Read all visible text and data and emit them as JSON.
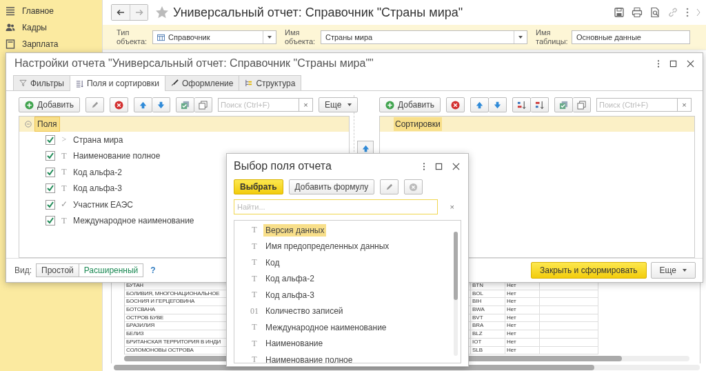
{
  "sidebar": {
    "items": [
      {
        "label": "Главное"
      },
      {
        "label": "Кадры"
      },
      {
        "label": "Зарплата"
      }
    ]
  },
  "header": {
    "title": "Универсальный отчет: Справочник \"Страны мира\""
  },
  "filters": [
    {
      "label": "Тип объекта:",
      "value": "Справочник",
      "kind": "select"
    },
    {
      "label": "Имя объекта:",
      "value": "Страны мира",
      "kind": "select"
    },
    {
      "label": "Имя таблицы:",
      "value": "Основные данные",
      "kind": "field"
    }
  ],
  "report": {
    "rows": [
      [
        "БУТАН",
        "BTN",
        "Нет"
      ],
      [
        "БОЛИВИЯ, МНОГОНАЦИОНАЛЬНОЕ",
        "BOL",
        "Нет"
      ],
      [
        "БОСНИЯ И ГЕРЦЕГОВИНА",
        "BIH",
        "Нет"
      ],
      [
        "БОТСВАНА",
        "BWA",
        "Нет"
      ],
      [
        "ОСТРОВ БУВЕ",
        "BVT",
        "Нет"
      ],
      [
        "БРАЗИЛИЯ",
        "BRA",
        "Нет"
      ],
      [
        "БЕЛИЗ",
        "BLZ",
        "Нет"
      ],
      [
        "БРИТАНСКАЯ ТЕРРИТОРИЯ В ИНДИ",
        "IOT",
        "Нет"
      ],
      [
        "СОЛОМОНОВЫ ОСТРОВА",
        "SLB",
        "Нет"
      ]
    ]
  },
  "settings": {
    "title": "Настройки отчета \"Универсальный отчет: Справочник \"Страны мира\"\"",
    "tabs": [
      {
        "label": "Фильтры",
        "selected": false
      },
      {
        "label": "Поля и сортировки",
        "selected": true
      },
      {
        "label": "Оформление",
        "selected": false
      },
      {
        "label": "Структура",
        "selected": false
      }
    ],
    "fields": {
      "add": "Добавить",
      "search_placeholder": "Поиск (Ctrl+F)",
      "clear": "×",
      "more": "Еще",
      "root": {
        "label": "Поля",
        "expanded": true,
        "children": [
          {
            "mark": ">",
            "label": "Страна мира",
            "checked": true
          },
          {
            "mark": "T",
            "label": "Наименование полное",
            "checked": true
          },
          {
            "mark": "T",
            "label": "Код альфа-2",
            "checked": true
          },
          {
            "mark": "T",
            "label": "Код альфа-3",
            "checked": true
          },
          {
            "mark": "✓",
            "label": "Участник ЕАЭС",
            "checked": true
          },
          {
            "mark": "T",
            "label": "Международное наименование",
            "checked": true
          }
        ]
      }
    },
    "sorting": {
      "add": "Добавить",
      "search_placeholder": "Поиск (Ctrl+F)",
      "clear": "×",
      "header": "Сортировки"
    },
    "view_label": "Вид:",
    "views": [
      {
        "label": "Простой",
        "selected": false
      },
      {
        "label": "Расширенный",
        "selected": true
      }
    ],
    "help": "?",
    "primary": "Закрыть и сформировать",
    "more": "Еще"
  },
  "picker": {
    "title": "Выбор поля отчета",
    "choose": "Выбрать",
    "add_formula": "Добавить формулу",
    "search_placeholder": "Найти...",
    "clear": "×",
    "items": [
      {
        "mark": "T",
        "label": "Версия данных",
        "selected": true
      },
      {
        "mark": "T",
        "label": "Имя предопределенных данных",
        "selected": false
      },
      {
        "mark": "T",
        "label": "Код",
        "selected": false
      },
      {
        "mark": "T",
        "label": "Код альфа-2",
        "selected": false
      },
      {
        "mark": "T",
        "label": "Код альфа-3",
        "selected": false
      },
      {
        "mark": "01",
        "label": "Количество записей",
        "selected": false
      },
      {
        "mark": "T",
        "label": "Международное наименование",
        "selected": false
      },
      {
        "mark": "T",
        "label": "Наименование",
        "selected": false
      },
      {
        "mark": "T",
        "label": "Наименование полное",
        "selected": false
      }
    ]
  }
}
